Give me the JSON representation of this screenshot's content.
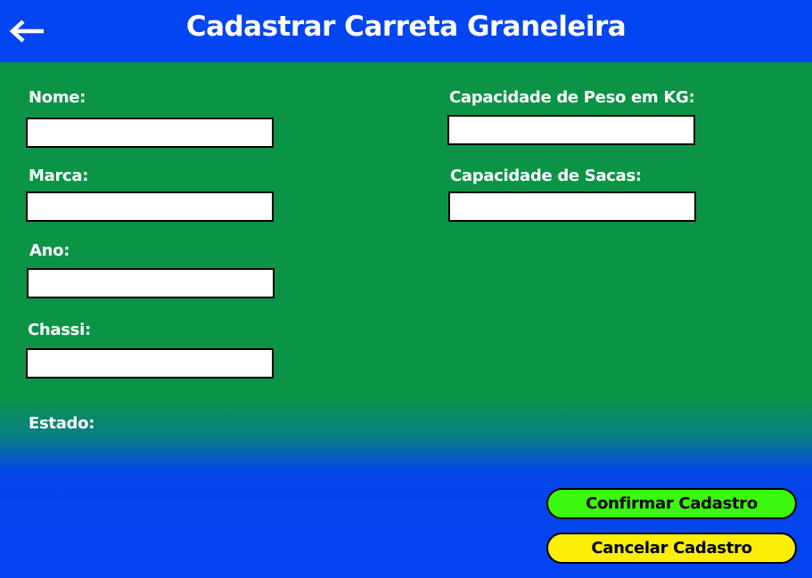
{
  "header": {
    "title": "Cadastrar Carreta Graneleira",
    "back_icon": "arrow-left-icon"
  },
  "form": {
    "nome": {
      "label": "Nome:",
      "value": ""
    },
    "marca": {
      "label": "Marca:",
      "value": ""
    },
    "ano": {
      "label": "Ano:",
      "value": ""
    },
    "chassi": {
      "label": "Chassi:",
      "value": ""
    },
    "estado": {
      "label": "Estado:"
    },
    "capacidade_peso": {
      "label": "Capacidade de Peso em KG:",
      "value": ""
    },
    "capacidade_sacas": {
      "label": "Capacidade de Sacas:",
      "value": ""
    }
  },
  "actions": {
    "confirm_label": "Confirmar Cadastro",
    "cancel_label": "Cancelar Cadastro"
  },
  "colors": {
    "header_blue": "#0345f0",
    "form_green": "#0b9446",
    "confirm_green": "#3bf90c",
    "cancel_yellow": "#fcee06"
  }
}
